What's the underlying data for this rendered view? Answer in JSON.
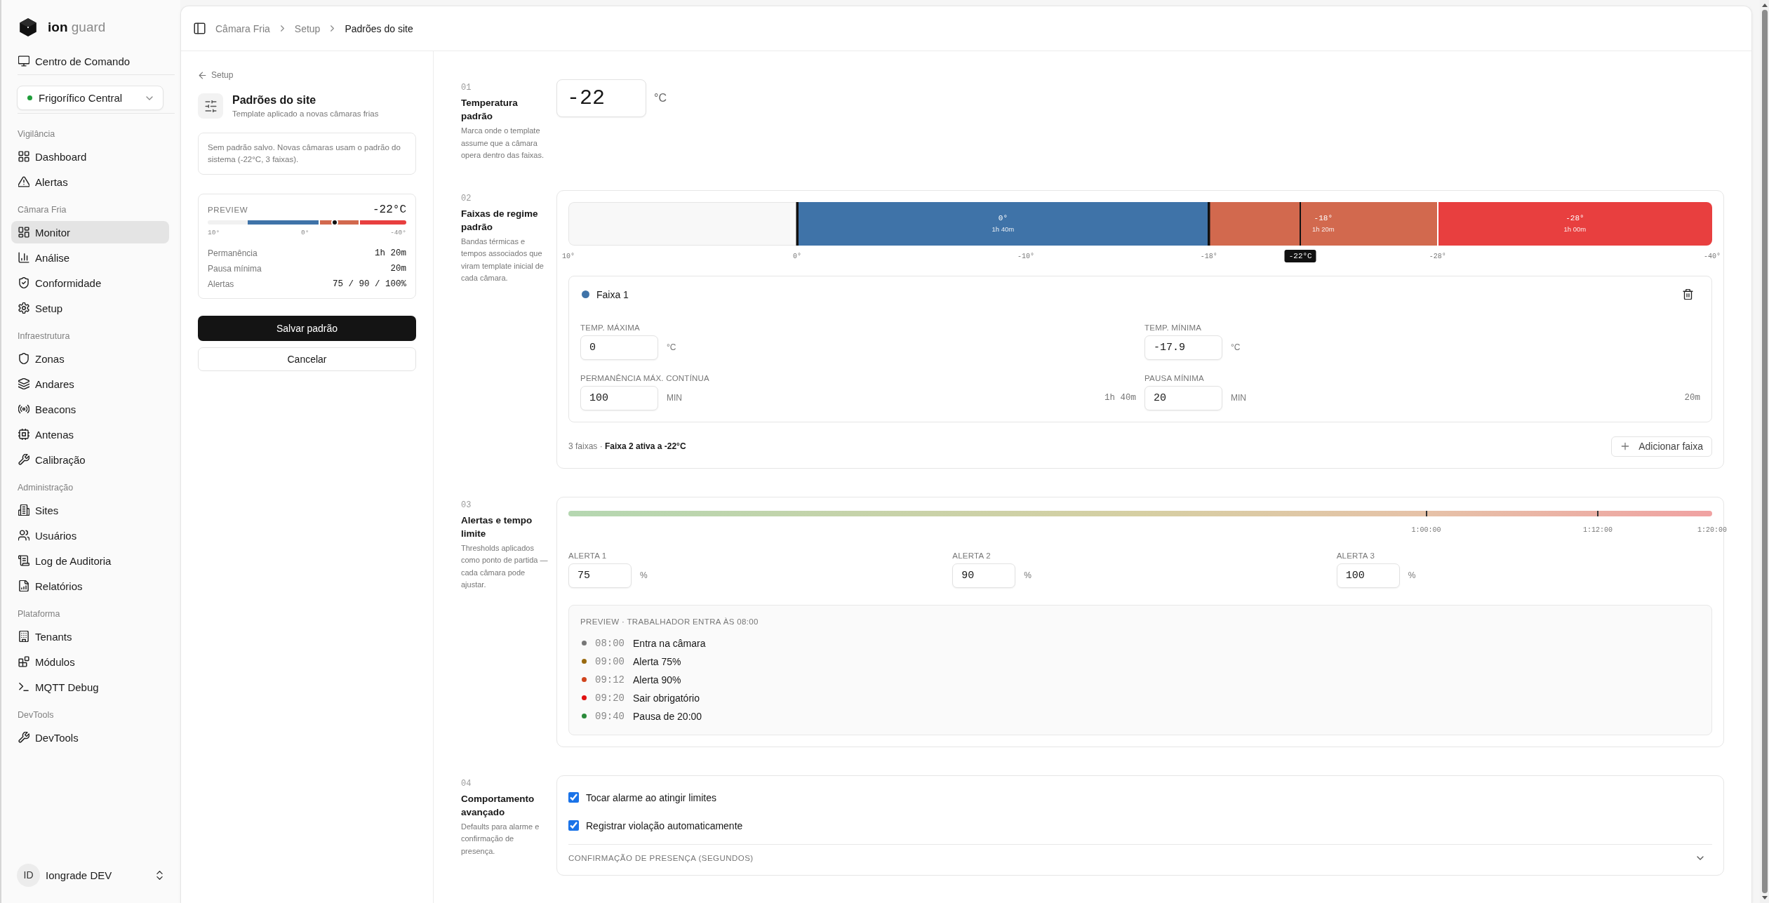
{
  "brand": {
    "name": "**ion** guard"
  },
  "sidebar": {
    "command_center": {
      "label": "Centro de Comando",
      "selected": false
    },
    "site_selector": {
      "label": "Frigorífico Central",
      "online": true
    },
    "groups": [
      {
        "label": "Vigilância",
        "items": [
          {
            "label": "Dashboard",
            "selected": false
          },
          {
            "label": "Alertas",
            "selected": false
          }
        ]
      },
      {
        "label": "Câmara Fria",
        "items": [
          {
            "label": "Monitor",
            "selected": true
          },
          {
            "label": "Análise",
            "selected": false
          },
          {
            "label": "Conformidade",
            "selected": false
          },
          {
            "label": "Setup",
            "selected": false
          }
        ]
      },
      {
        "label": "Infraestrutura",
        "items": [
          {
            "label": "Zonas",
            "selected": false
          },
          {
            "label": "Andares",
            "selected": false
          },
          {
            "label": "Beacons",
            "selected": false
          },
          {
            "label": "Antenas",
            "selected": false
          },
          {
            "label": "Calibração",
            "selected": false
          }
        ]
      },
      {
        "label": "Administração",
        "items": [
          {
            "label": "Sites",
            "selected": false
          },
          {
            "label": "Usuários",
            "selected": false
          },
          {
            "label": "Log de Auditoria",
            "selected": false
          },
          {
            "label": "Relatórios",
            "selected": false
          }
        ]
      },
      {
        "label": "Plataforma",
        "items": [
          {
            "label": "Tenants",
            "selected": false
          },
          {
            "label": "Módulos",
            "selected": false
          },
          {
            "label": "MQTT Debug",
            "selected": false
          }
        ]
      },
      {
        "label": "DevTools",
        "items": [
          {
            "label": "DevTools",
            "selected": false
          }
        ]
      }
    ],
    "user": {
      "initials": "ID",
      "name": "Iongrade DEV"
    }
  },
  "breadcrumb": [
    {
      "label": "Câmara Fria",
      "current": false
    },
    {
      "label": "Setup",
      "current": false
    },
    {
      "label": "Padrões do site",
      "current": true
    }
  ],
  "side_panel": {
    "back_link": "Setup",
    "title": "Padrões do site",
    "subtitle": "Template aplicado a novas câmaras frias",
    "notice": "Sem padrão salvo. Novas câmaras usam o padrão do sistema (-22°C, 3 faixas).",
    "preview": {
      "label": "PREVIEW",
      "temperature": "-22°C",
      "scale": [
        "10°",
        "0°",
        "-40°"
      ],
      "stats": [
        {
          "label": "Permanência",
          "value": "1h 20m"
        },
        {
          "label": "Pausa mínima",
          "value": "20m"
        },
        {
          "label": "Alertas",
          "value": "75 / 90 / 100%"
        }
      ]
    },
    "buttons": [
      {
        "label": "Salvar padrão",
        "kind": "primary"
      },
      {
        "label": "Cancelar",
        "kind": "secondary"
      }
    ]
  },
  "sections": [
    {
      "kind": "temperature",
      "number": "01",
      "title": "Temperatura padrão",
      "description": "Marca onde o template assume que a câmara opera dentro das faixas.",
      "value": "-22",
      "unit": "°C"
    },
    {
      "kind": "bands",
      "number": "02",
      "title": "Faixas de regime padrão",
      "description": "Bandas térmicas e tempos associados que viram template inicial de cada câmara.",
      "bar": {
        "segments": [
          {
            "kind": "empty"
          },
          {
            "kind": "band",
            "title": "0°",
            "duration": "1h 40m",
            "color": "#3f73a8",
            "selected": true
          },
          {
            "kind": "band",
            "title": "-18°",
            "duration": "1h 20m",
            "color": "#d2694e",
            "selected": false
          },
          {
            "kind": "band",
            "title": "-28°",
            "duration": "1h 00m",
            "color": "#e83f3f",
            "selected": false
          }
        ],
        "handles": [
          {
            "level": 0.2
          },
          {
            "level": 0.56
          },
          {
            "level": 0.76
          }
        ],
        "ticks": [
          {
            "label": "10°",
            "level": 0
          },
          {
            "label": "0°",
            "level": 0.2
          },
          {
            "label": "-10°",
            "level": 0.4
          },
          {
            "label": "-18°",
            "level": 0.56
          },
          {
            "label": "-28°",
            "level": 0.76
          },
          {
            "label": "-40°",
            "level": 1
          }
        ],
        "marker": {
          "label": "-22°C",
          "level": 0.64
        }
      },
      "editor": {
        "title": "Faixa 1",
        "fields": [
          {
            "label": "TEMP. MÁXIMA",
            "value": "0",
            "unit": "°C"
          },
          {
            "label": "TEMP. MÍNIMA",
            "value": "-17.9",
            "unit": "°C"
          },
          {
            "label": "PERMANÊNCIA MÁX. CONTÍNUA",
            "value": "100",
            "unit": "MIN",
            "note": "1h 40m"
          },
          {
            "label": "PAUSA MÍNIMA",
            "value": "20",
            "unit": "MIN",
            "note": "20m"
          }
        ]
      },
      "summary": "3 faixas · **Faixa 2 ativa a -22°C**",
      "add_button": "Adicionar faixa"
    },
    {
      "kind": "alerts",
      "number": "03",
      "title": "Alertas e tempo limite",
      "description": "Thresholds aplicados como ponto de partida — cada câmara pode ajustar.",
      "timeline": [
        {
          "label": "1:00:00",
          "level": 0.75
        },
        {
          "label": "1:12:00",
          "level": 0.9
        },
        {
          "label": "1:20:00",
          "level": 1
        }
      ],
      "fields": [
        {
          "label": "ALERTA 1",
          "value": "75",
          "unit": "%"
        },
        {
          "label": "ALERTA 2",
          "value": "90",
          "unit": "%"
        },
        {
          "label": "ALERTA 3",
          "value": "100",
          "unit": "%"
        }
      ],
      "preview": {
        "title": "PREVIEW · TRABALHADOR ENTRA ÀS 08:00",
        "events": [
          {
            "time": "08:00",
            "text": "Entra na câmara",
            "color": "#777777"
          },
          {
            "time": "09:00",
            "text": "Alerta 75%",
            "color": "#9a6a10"
          },
          {
            "time": "09:12",
            "text": "Alerta 90%",
            "color": "#d0441c"
          },
          {
            "time": "09:20",
            "text": "Sair obrigatório",
            "color": "#e01010"
          },
          {
            "time": "09:40",
            "text": "Pausa de 20:00",
            "color": "#2a8a3a"
          }
        ]
      }
    },
    {
      "kind": "behavior",
      "number": "04",
      "title": "Comportamento avançado",
      "description": "Defaults para alarme e confirmação de presença.",
      "options": [
        {
          "label": "Tocar alarme ao atingir limites",
          "checked": true
        },
        {
          "label": "Registrar violação automaticamente",
          "checked": true
        }
      ],
      "collapsible": {
        "label": "CONFIRMAÇÃO DE PRESENÇA (SEGUNDOS)",
        "expanded": false
      }
    }
  ]
}
